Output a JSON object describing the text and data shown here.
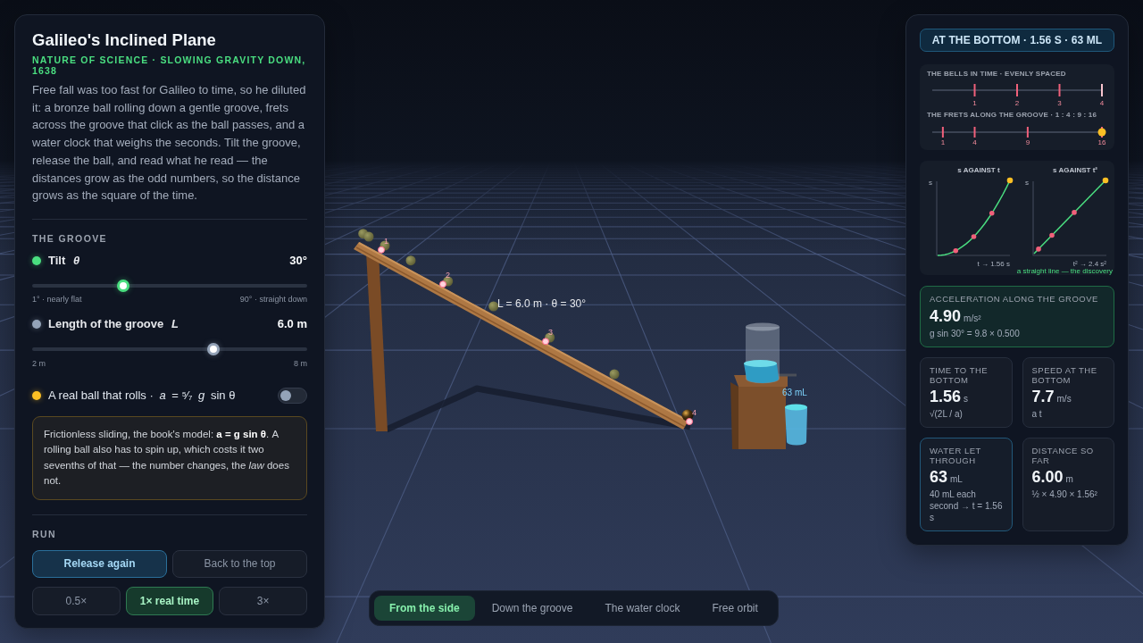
{
  "panel": {
    "title": "Galileo's Inclined Plane",
    "subtitle": "NATURE OF SCIENCE · SLOWING GRAVITY DOWN, 1638",
    "intro": "Free fall was too fast for Galileo to time, so he diluted it: a bronze ball rolling down a gentle groove, frets across the groove that click as the ball passes, and a water clock that weighs the seconds. Tilt the groove, release the ball, and read what he read — the distances grow as the odd numbers, so the distance grows as the square of the time.",
    "groove": {
      "heading": "THE GROOVE",
      "sliders": [
        {
          "label": "Tilt *θ*",
          "value": "30°",
          "color": "#4ade80",
          "level": 0.33,
          "min_label": "1° · nearly flat",
          "max_label": "90° · straight down"
        },
        {
          "label": "Length of the groove *L*",
          "value": "6.0 m",
          "color": "#94a3b8",
          "level": 0.66,
          "min_label": "2 m",
          "max_label": "8 m"
        }
      ],
      "rolling": {
        "label": "A real ball that rolls · *a* = ⁵⁄₇ *g* sin θ",
        "color": "#fbbf24",
        "on": false
      },
      "note": "Frictionless sliding, the book's model: **a = g sin θ**. A rolling ball also has to spin up, which costs it two sevenths of that — the number changes, the *law* does not."
    },
    "run": {
      "heading": "RUN",
      "actions": [
        {
          "label": "Release again",
          "kind": "primary"
        },
        {
          "label": "Back to the top",
          "kind": "secondary"
        }
      ],
      "speeds": [
        {
          "label": "0.5×",
          "selected": false
        },
        {
          "label": "1× real time",
          "selected": true
        },
        {
          "label": "3×",
          "selected": false
        }
      ]
    }
  },
  "scene": {
    "dimension_label": "L = 6.0 m · θ = 30°",
    "fret_numbers": [
      "1",
      "2",
      "3",
      "4"
    ],
    "water_label": "63 mL"
  },
  "readout": {
    "headline": "AT THE BOTTOM · 1.56 S · 63 ML",
    "bells": {
      "title": "THE BELLS IN TIME · EVENLY SPACED",
      "ticks": [
        {
          "label": "1",
          "latest": false
        },
        {
          "label": "2",
          "latest": false
        },
        {
          "label": "3",
          "latest": false
        },
        {
          "label": "4",
          "latest": true
        }
      ]
    },
    "frets": {
      "title": "THE FRETS ALONG THE GROOVE · 1 : 4 : 9 : 16",
      "ticks": [
        {
          "label": "1"
        },
        {
          "label": "4"
        },
        {
          "label": "9"
        },
        {
          "label": "16"
        }
      ]
    },
    "plots": [
      {
        "kind": "curve",
        "title": "s AGAINST t",
        "y_label": "s",
        "x_label": "t → 1.56 s"
      },
      {
        "kind": "straight",
        "title": "s AGAINST t²",
        "y_label": "s",
        "x_label": "t² → 2.4 s²"
      }
    ],
    "plots_caption": "a straight line — the discovery",
    "cards": [
      {
        "kind": "highlight",
        "label": "ACCELERATION ALONG THE GROOVE",
        "value": "4.90",
        "unit": "m/s²",
        "formula": "g sin 30° = 9.8 × 0.500"
      },
      {
        "kind": "plain",
        "label": "TIME TO THE BOTTOM",
        "value": "1.56",
        "unit": "s",
        "formula": "√(2L / a)"
      },
      {
        "kind": "plain",
        "label": "SPEED AT THE BOTTOM",
        "value": "7.7",
        "unit": "m/s",
        "formula": "a t"
      },
      {
        "kind": "accent",
        "label": "WATER LET THROUGH",
        "value": "63",
        "unit": "mL",
        "formula": "40 mL each second → t = 1.56 s"
      },
      {
        "kind": "plain",
        "label": "DISTANCE SO FAR",
        "value": "6.00",
        "unit": "m",
        "formula": "½ × 4.90 × 1.56²"
      }
    ]
  },
  "views": [
    {
      "label": "From the side",
      "selected": true
    },
    {
      "label": "Down the groove",
      "selected": false
    },
    {
      "label": "The water clock",
      "selected": false
    },
    {
      "label": "Free orbit",
      "selected": false
    }
  ]
}
